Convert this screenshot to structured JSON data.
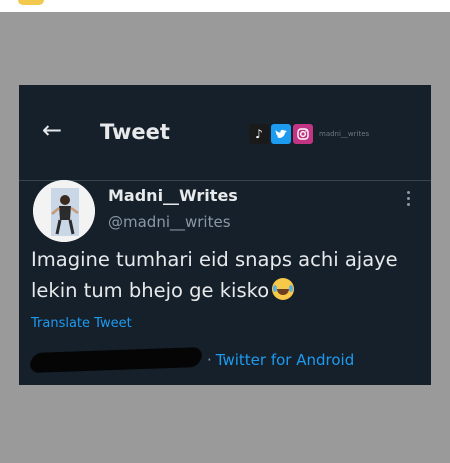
{
  "header": {
    "back_icon": "arrow-left-icon",
    "title": "Tweet",
    "watermark_icons": [
      "tiktok-icon",
      "twitter-icon",
      "instagram-icon"
    ],
    "watermark_text": "madni__writes"
  },
  "tweet": {
    "author_name": "Madni__Writes",
    "author_handle": "@madni__writes",
    "text": "Imagine tumhari eid snaps achi ajaye lekin tum bhejo ge kisko",
    "emoji": "face-with-tears-of-joy",
    "translate_label": "Translate Tweet",
    "separator": "·",
    "client": "Twitter for Android",
    "more_icon": "more-vertical-icon"
  },
  "colors": {
    "card_background": "#15202b",
    "primary_text": "#e7e9ea",
    "secondary_text": "#8b98a5",
    "accent": "#1d9bf0",
    "photo_background": "#9a9a9a"
  }
}
